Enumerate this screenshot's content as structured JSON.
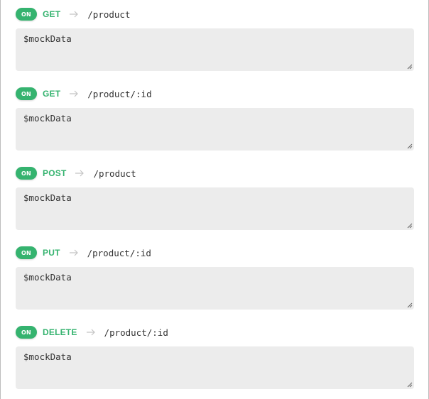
{
  "toggle_on_label": "ON",
  "accent_color": "#35b36f",
  "endpoints": [
    {
      "enabled": true,
      "method": "GET",
      "path": "/product",
      "body": "$mockData"
    },
    {
      "enabled": true,
      "method": "GET",
      "path": "/product/:id",
      "body": "$mockData"
    },
    {
      "enabled": true,
      "method": "POST",
      "path": "/product",
      "body": "$mockData"
    },
    {
      "enabled": true,
      "method": "PUT",
      "path": "/product/:id",
      "body": "$mockData"
    },
    {
      "enabled": true,
      "method": "DELETE",
      "path": "/product/:id",
      "body": "$mockData"
    }
  ],
  "icons": {
    "separator": "arrow-right-icon",
    "grip": "resize-grip-icon"
  }
}
